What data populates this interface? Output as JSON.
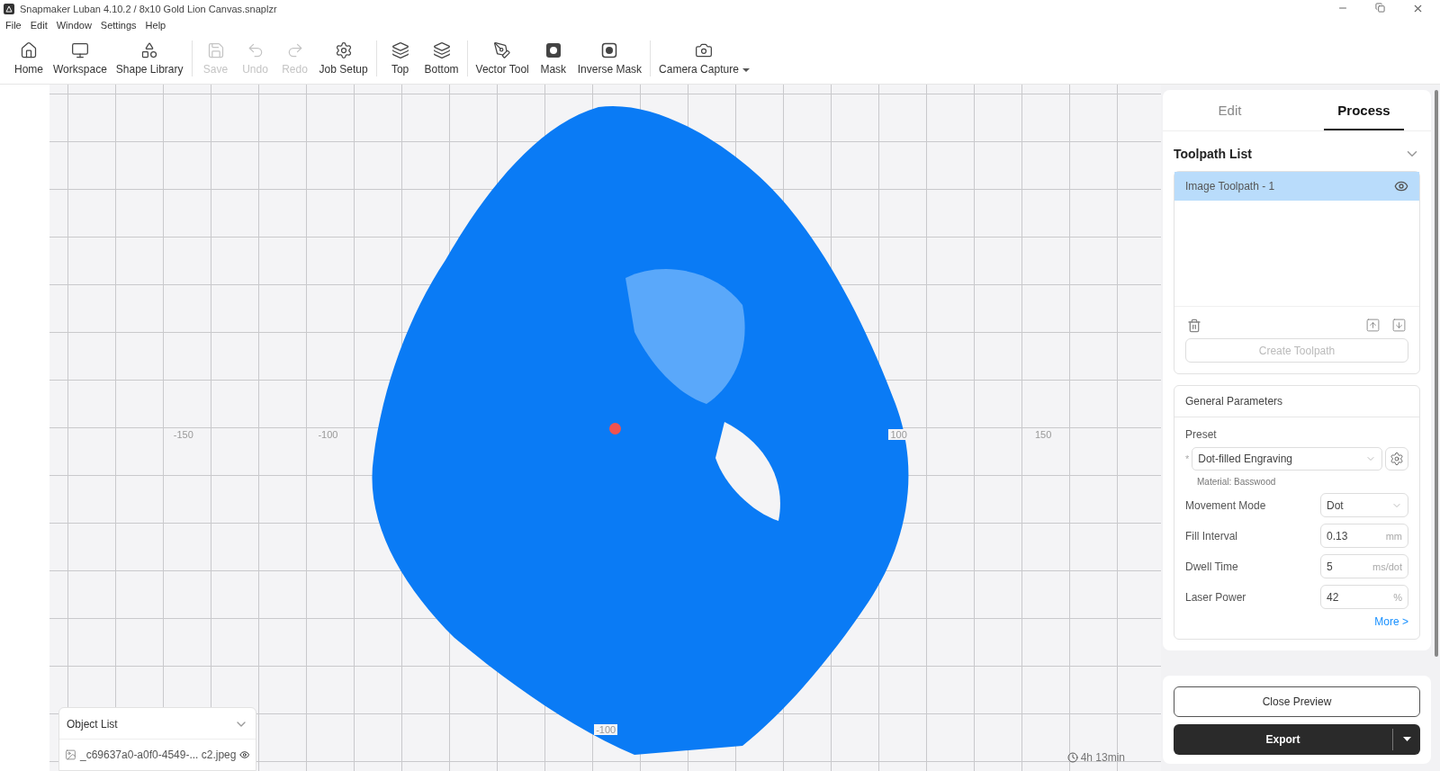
{
  "window": {
    "title": "Snapmaker Luban 4.10.2 / 8x10 Gold Lion Canvas.snaplzr"
  },
  "menu": [
    "File",
    "Edit",
    "Window",
    "Settings",
    "Help"
  ],
  "toolbar": [
    {
      "label": "Home",
      "disabled": false
    },
    {
      "label": "Workspace",
      "disabled": false
    },
    {
      "label": "Shape Library",
      "disabled": false
    },
    {
      "label": "Save",
      "disabled": true
    },
    {
      "label": "Undo",
      "disabled": true
    },
    {
      "label": "Redo",
      "disabled": true
    },
    {
      "label": "Job Setup",
      "disabled": false
    },
    {
      "label": "Top",
      "disabled": false
    },
    {
      "label": "Bottom",
      "disabled": false
    },
    {
      "label": "Vector Tool",
      "disabled": false
    },
    {
      "label": "Mask",
      "disabled": false
    },
    {
      "label": "Inverse Mask",
      "disabled": false
    },
    {
      "label": "Camera Capture",
      "disabled": false
    }
  ],
  "canvas": {
    "axis_labels": [
      "-150",
      "-100",
      "100",
      "150",
      "-100"
    ],
    "object_list": {
      "title": "Object List",
      "expanded": true,
      "items": [
        {
          "name": "_c69637a0-a0f0-4549-... c2.jpeg",
          "visible": true
        }
      ]
    },
    "estimate": "4h 13min"
  },
  "panel": {
    "tabs": [
      {
        "label": "Edit",
        "selected": false
      },
      {
        "label": "Process",
        "selected": true
      }
    ],
    "toolpath_list": {
      "title": "Toolpath List",
      "expanded": true,
      "items": [
        {
          "name": "Image Toolpath - 1",
          "selected": true,
          "visible": true
        }
      ],
      "create_button": {
        "label": "Create Toolpath",
        "disabled": true
      }
    },
    "general": {
      "title": "General Parameters",
      "preset_label": "Preset",
      "required_mark": "*",
      "preset": "Dot-filled Engraving",
      "material": "Material: Basswood",
      "fields": [
        {
          "kind": "select",
          "label": "Movement Mode",
          "value": "Dot"
        },
        {
          "kind": "input",
          "label": "Fill Interval",
          "value": "0.13",
          "unit": "mm"
        },
        {
          "kind": "input",
          "label": "Dwell Time",
          "value": "5",
          "unit": "ms/dot"
        },
        {
          "kind": "input",
          "label": "Laser Power",
          "value": "42",
          "unit": "%"
        }
      ],
      "more": "More >"
    },
    "buttons": [
      {
        "kind": "outline",
        "label": "Close Preview"
      },
      {
        "kind": "split",
        "label": "Export"
      }
    ]
  }
}
